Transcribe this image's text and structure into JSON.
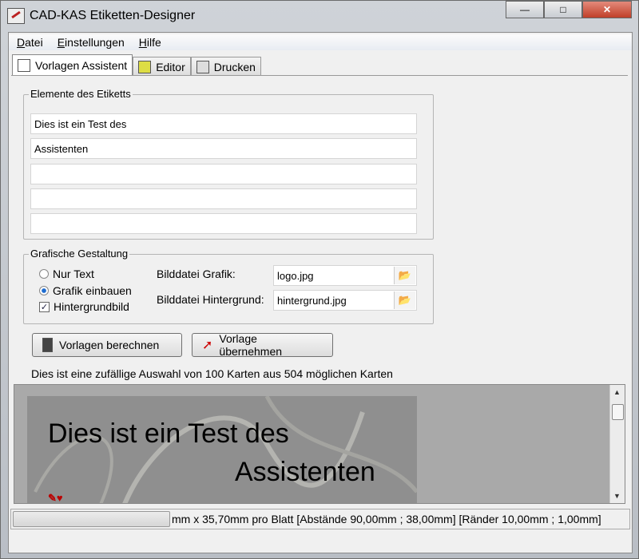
{
  "window": {
    "title": "CAD-KAS Etiketten-Designer",
    "controls": [
      "minimize",
      "maximize",
      "close"
    ]
  },
  "menu": [
    {
      "label": "Datei",
      "key": "D",
      "rest": "atei"
    },
    {
      "label": "Einstellungen",
      "key": "E",
      "rest": "instellungen"
    },
    {
      "label": "Hilfe",
      "key": "H",
      "rest": "ilfe"
    }
  ],
  "tabs": [
    {
      "label": "Vorlagen Assistent",
      "icon": "document-icon",
      "active": true
    },
    {
      "label": "Editor",
      "icon": "editor-icon"
    },
    {
      "label": "Drucken",
      "icon": "printer-icon"
    }
  ],
  "elements": {
    "legend": "Elemente des Etiketts",
    "fields": [
      "Dies ist ein Test des",
      "Assistenten",
      "",
      "",
      ""
    ]
  },
  "graphics": {
    "legend": "Grafische Gestaltung",
    "nur_text": "Nur Text",
    "grafik_einbauen": "Grafik einbauen",
    "hintergrundbild": "Hintergrundbild",
    "selected": "Grafik einbauen",
    "hintergrund_checked": true,
    "bild_grafik_label": "Bilddatei Grafik:",
    "bild_grafik_value": "logo.jpg",
    "bild_hintergrund_label": "Bilddatei Hintergrund:",
    "bild_hintergrund_value": "hintergrund.jpg"
  },
  "buttons": {
    "berechnen": "Vorlagen berechnen",
    "uebernehmen": "Vorlage übernehmen"
  },
  "info": "Dies ist eine zufällige Auswahl von 100 Karten aus 504 möglichen Karten",
  "preview": {
    "line1": "Dies ist ein Test des",
    "line2": "Assistenten"
  },
  "status": {
    "text": "mm x 35,70mm pro Blatt [Abstände 90,00mm ; 38,00mm] [Ränder 10,00mm ; 1,00mm]"
  }
}
